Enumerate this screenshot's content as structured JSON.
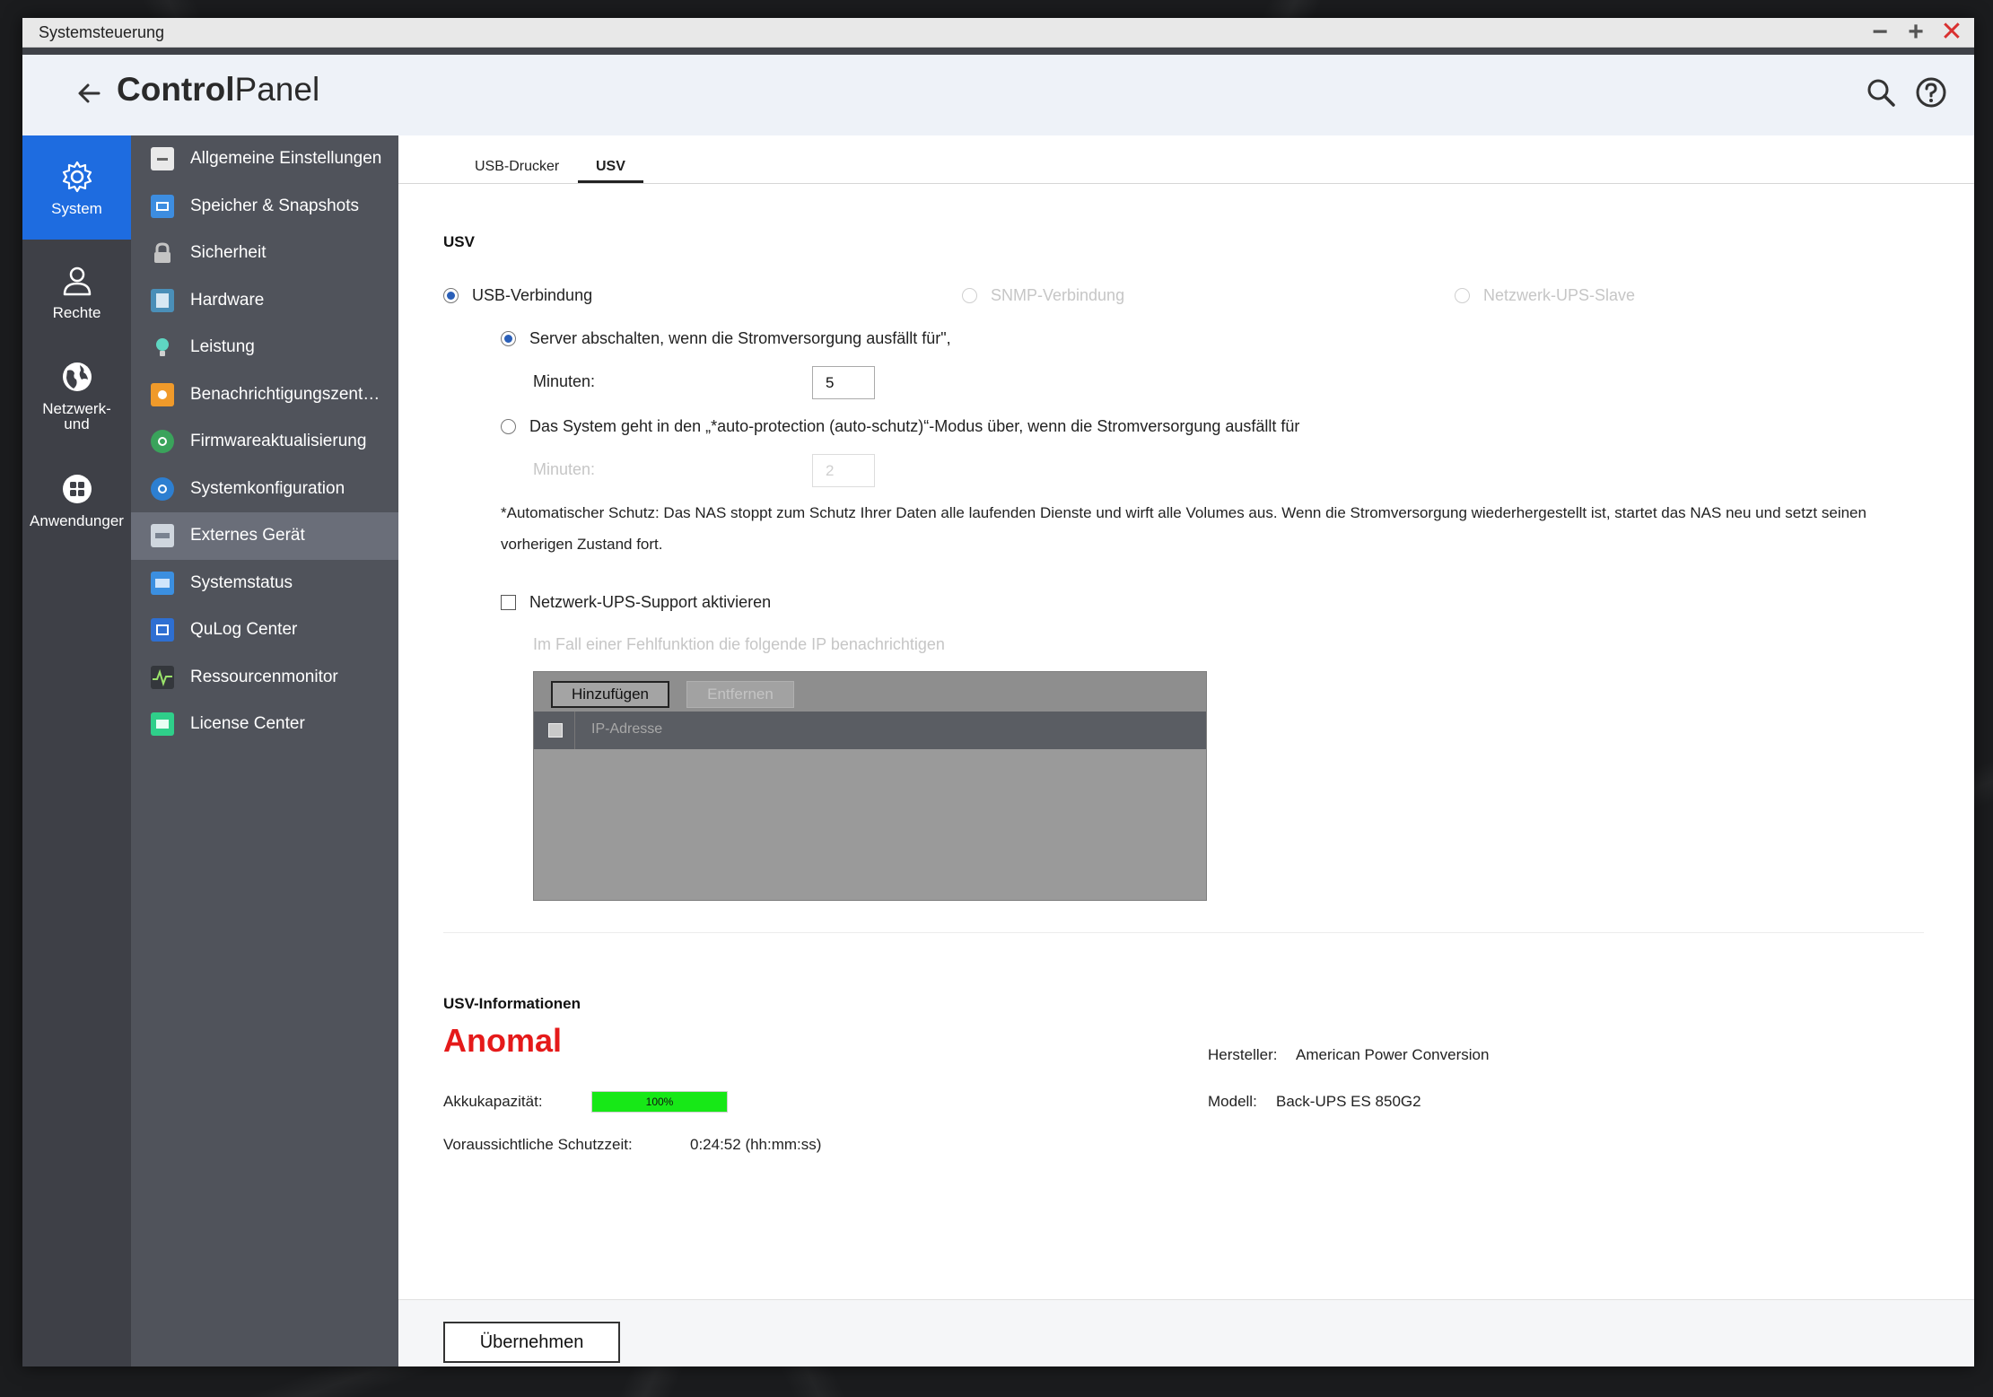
{
  "window": {
    "title": "Systemsteuerung"
  },
  "header": {
    "title_bold": "Control",
    "title_light": "Panel"
  },
  "leftnav": [
    {
      "label": "System",
      "icon": "gear-icon"
    },
    {
      "label": "Rechte",
      "icon": "user-icon"
    },
    {
      "label": "Netzwerk-\nund",
      "icon": "globe-icon"
    },
    {
      "label": "Anwendunger",
      "icon": "grid-icon"
    }
  ],
  "submenu": [
    {
      "label": "Allgemeine Einstellungen",
      "icon": "settings-doc-icon",
      "color": "#e9e9e9"
    },
    {
      "label": "Speicher & Snapshots",
      "icon": "storage-icon",
      "color": "#3d8de0"
    },
    {
      "label": "Sicherheit",
      "icon": "lock-icon",
      "color": "#c4c4c4"
    },
    {
      "label": "Hardware",
      "icon": "hardware-icon",
      "color": "#4a8fb8"
    },
    {
      "label": "Leistung",
      "icon": "bulb-icon",
      "color": "#5fd6c2"
    },
    {
      "label": "Benachrichtigungszentru...",
      "icon": "notification-icon",
      "color": "#f09a2a"
    },
    {
      "label": "Firmwareaktualisierung",
      "icon": "firmware-icon",
      "color": "#3aa35b"
    },
    {
      "label": "Systemkonfiguration",
      "icon": "config-icon",
      "color": "#2d7fd1"
    },
    {
      "label": "Externes Gerät",
      "icon": "external-device-icon",
      "color": "#cfd6de"
    },
    {
      "label": "Systemstatus",
      "icon": "monitor-icon",
      "color": "#3b8fe0"
    },
    {
      "label": "QuLog Center",
      "icon": "log-icon",
      "color": "#2e6fd2"
    },
    {
      "label": "Ressourcenmonitor",
      "icon": "resource-icon",
      "color": "#34373c"
    },
    {
      "label": "License Center",
      "icon": "license-icon",
      "color": "#2fcf8a"
    }
  ],
  "tabs": [
    {
      "label": "USB-Drucker"
    },
    {
      "label": "USV"
    }
  ],
  "usv": {
    "section_title": "USV",
    "conn_usb": "USB-Verbindung",
    "conn_snmp": "SNMP-Verbindung",
    "conn_slave": "Netzwerk-UPS-Slave",
    "opt_shutdown": "Server abschalten, wenn die Stromversorgung ausfällt für\",",
    "minutes_label": "Minuten:",
    "minutes_value": "5",
    "opt_autoprotect": "Das System geht in den „*auto-protection (auto-schutz)“-Modus über, wenn die Stromversorgung ausfällt für",
    "minutes2_label": "Minuten:",
    "minutes2_value": "2",
    "note": "*Automatischer Schutz: Das NAS stoppt zum Schutz Ihrer Daten alle laufenden Dienste und wirft alle Volumes aus. Wenn die Stromversorgung wiederhergestellt ist, startet das NAS neu und setzt seinen vorherigen Zustand fort.",
    "network_support": "Netzwerk-UPS-Support aktivieren",
    "notify_label": "Im Fall einer Fehlfunktion die folgende IP benachrichtigen",
    "btn_add": "Hinzufügen",
    "btn_remove": "Entfernen",
    "col_ip": "IP-Adresse"
  },
  "info": {
    "section_title": "USV-Informationen",
    "status": "Anomal",
    "battery_label": "Akkukapazität:",
    "battery_pct": "100%",
    "battery_fraction": 1.0,
    "runtime_label": "Voraussichtliche Schutzzeit:",
    "runtime_value": "0:24:52 (hh:mm:ss)",
    "maker_label": "Hersteller:",
    "maker_value": "American Power Conversion",
    "model_label": "Modell:",
    "model_value": "Back-UPS ES 850G2"
  },
  "footer": {
    "apply": "Übernehmen"
  }
}
